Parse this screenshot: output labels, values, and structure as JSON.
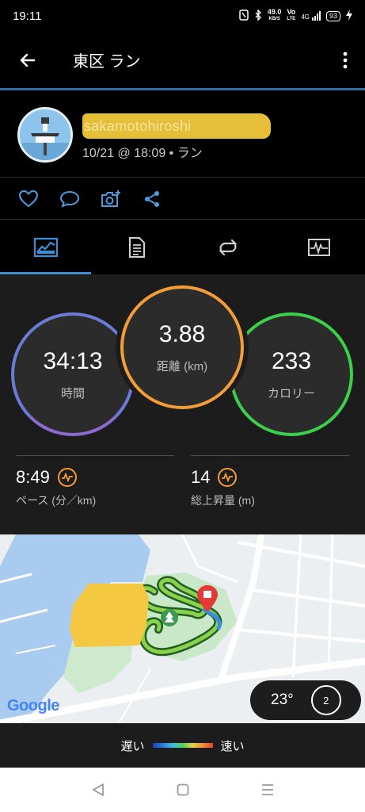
{
  "status_bar": {
    "time": "19:11",
    "net_speed": "49.0",
    "net_unit": "KB/S",
    "vol": "Vo",
    "lte": "LTE",
    "signal_label": "4G",
    "battery": "93"
  },
  "app_bar": {
    "title": "東区 ラン"
  },
  "profile": {
    "username": "sakamotohiroshi",
    "subtitle": "10/21 @ 18:09 • ラン"
  },
  "tabs": [
    "overview-icon",
    "details-icon",
    "laps-icon",
    "chart-icon"
  ],
  "stats": {
    "time": {
      "value": "34:13",
      "label": "時間"
    },
    "distance": {
      "value": "3.88",
      "label": "距離 (km)"
    },
    "calories": {
      "value": "233",
      "label": "カロリー"
    },
    "pace": {
      "value": "8:49",
      "label": "ペース (分／km)"
    },
    "ascent": {
      "value": "14",
      "label": "総上昇量 (m)"
    }
  },
  "map": {
    "brand": "Google",
    "weather_temp": "23°",
    "wind": "2"
  },
  "legend": {
    "slow": "遅い",
    "fast": "速い"
  },
  "colors": {
    "accent": "#3a8fd6",
    "time_ring": "#6b7bd6",
    "distance_ring": "#f29d38",
    "calorie_ring": "#3ccf4a"
  }
}
